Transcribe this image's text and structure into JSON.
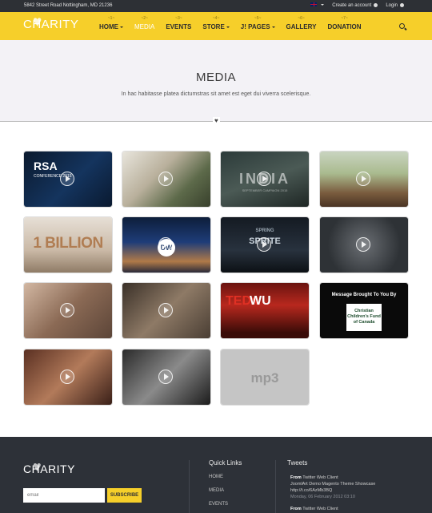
{
  "topbar": {
    "address": "5842 Street Road Nottingham, MD 21236",
    "create_account": "Create an account",
    "login": "Login"
  },
  "brand": {
    "logo_text": "CHARITY"
  },
  "nav": {
    "items": [
      {
        "num": "~1~",
        "label": "HOME",
        "dropdown": true,
        "active": false
      },
      {
        "num": "~2~",
        "label": "MEDIA",
        "dropdown": false,
        "active": true
      },
      {
        "num": "~3~",
        "label": "EVENTS",
        "dropdown": false,
        "active": false
      },
      {
        "num": "~4~",
        "label": "STORE",
        "dropdown": true,
        "active": false
      },
      {
        "num": "~5~",
        "label": "J! PAGES",
        "dropdown": true,
        "active": false
      },
      {
        "num": "~6~",
        "label": "GALLERY",
        "dropdown": false,
        "active": false
      },
      {
        "num": "~7~",
        "label": "DONATION",
        "dropdown": false,
        "active": false
      }
    ],
    "search_icon": "search-icon"
  },
  "hero": {
    "title": "MEDIA",
    "subtitle": "In hac habitasse platea dictumstras sit amet est eget dui viverra scelerisque."
  },
  "media": {
    "items": [
      {
        "caption": "RSA",
        "caption2": "CONFERENCE 2015",
        "has_play": true
      },
      {
        "caption": "",
        "caption2": "",
        "has_play": true
      },
      {
        "caption": "INDIA",
        "caption2": "SEPTEMBER CAMPAIGN 2015",
        "has_play": true
      },
      {
        "caption": "",
        "caption2": "",
        "has_play": true
      },
      {
        "caption": "1 BILLION",
        "caption2": "",
        "has_play": false
      },
      {
        "caption": "DW",
        "caption2": "",
        "has_play": true
      },
      {
        "caption": "SPRING",
        "caption2": "SPRITE",
        "has_play": true
      },
      {
        "caption": "",
        "caption2": "",
        "has_play": true
      },
      {
        "caption": "",
        "caption2": "",
        "has_play": true
      },
      {
        "caption": "",
        "caption2": "",
        "has_play": true
      },
      {
        "caption": "TEDx",
        "caption2": "WU",
        "has_play": false
      },
      {
        "caption": "Message Brought To You By",
        "caption2": "Christian Children's Fund of Canada",
        "has_play": false
      },
      {
        "caption": "",
        "caption2": "",
        "has_play": true
      },
      {
        "caption": "",
        "caption2": "",
        "has_play": true
      },
      {
        "caption": "mp3",
        "caption2": "",
        "has_play": false
      }
    ]
  },
  "footer": {
    "logo_text": "CHARITY",
    "email_placeholder": "email",
    "subscribe_label": "SUBSCRIBE",
    "quick_links_title": "Quick Links",
    "quick_links": [
      "HOME",
      "MEDIA",
      "EVENTS"
    ],
    "tweets_title": "Tweets",
    "tweets": [
      {
        "from_label": "From",
        "from": "Twitter Web Client",
        "text": "JoomlArt Demo Magento Theme Showcase http://t.co/6AzMb3BQ",
        "date": "Monday, 06 February 2012 03:10"
      },
      {
        "from_label": "From",
        "from": "Twitter Web Client",
        "text": "",
        "date": ""
      }
    ]
  },
  "colors": {
    "accent": "#f6cf2a",
    "topbar": "#2d3035",
    "footer": "#2d3138",
    "hero": "#f3f2f6"
  }
}
